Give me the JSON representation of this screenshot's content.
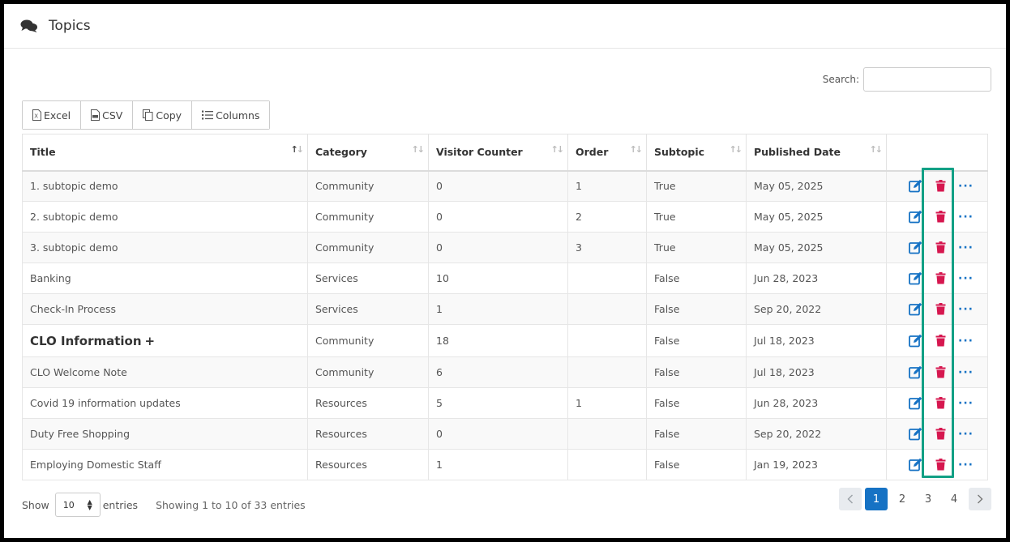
{
  "header": {
    "title": "Topics",
    "icon": "comments-icon"
  },
  "search": {
    "label": "Search:",
    "value": "",
    "placeholder": ""
  },
  "toolbar": {
    "excel": "Excel",
    "csv": "CSV",
    "copy": "Copy",
    "columns": "Columns"
  },
  "table": {
    "columns": [
      "Title",
      "Category",
      "Visitor Counter",
      "Order",
      "Subtopic",
      "Published Date"
    ],
    "rows": [
      {
        "title": "1. subtopic demo",
        "category": "Community",
        "visitors": "0",
        "order": "1",
        "subtopic": "True",
        "date": "May 05, 2025"
      },
      {
        "title": "2. subtopic demo",
        "category": "Community",
        "visitors": "0",
        "order": "2",
        "subtopic": "True",
        "date": "May 05, 2025"
      },
      {
        "title": "3. subtopic demo",
        "category": "Community",
        "visitors": "0",
        "order": "3",
        "subtopic": "True",
        "date": "May 05, 2025"
      },
      {
        "title": "Banking",
        "category": "Services",
        "visitors": "10",
        "order": "",
        "subtopic": "False",
        "date": "Jun 28, 2023"
      },
      {
        "title": "Check-In Process",
        "category": "Services",
        "visitors": "1",
        "order": "",
        "subtopic": "False",
        "date": "Sep 20, 2022"
      },
      {
        "title": "CLO Information",
        "category": "Community",
        "visitors": "18",
        "order": "",
        "subtopic": "False",
        "date": "Jul 18, 2023",
        "expand": "+"
      },
      {
        "title": "CLO Welcome Note",
        "category": "Community",
        "visitors": "6",
        "order": "",
        "subtopic": "False",
        "date": "Jul 18, 2023"
      },
      {
        "title": "Covid 19 information updates",
        "category": "Resources",
        "visitors": "5",
        "order": "1",
        "subtopic": "False",
        "date": "Jun 28, 2023"
      },
      {
        "title": "Duty Free Shopping",
        "category": "Resources",
        "visitors": "0",
        "order": "",
        "subtopic": "False",
        "date": "Sep 20, 2022"
      },
      {
        "title": "Employing Domestic Staff",
        "category": "Resources",
        "visitors": "1",
        "order": "",
        "subtopic": "False",
        "date": "Jan 19, 2023"
      }
    ]
  },
  "footer": {
    "show_label": "Show",
    "page_length": "10",
    "entries_label": "entries",
    "info": "Showing 1 to 10 of 33 entries"
  },
  "pagination": {
    "pages": [
      "1",
      "2",
      "3",
      "4"
    ],
    "current": "1"
  },
  "colors": {
    "edit": "#1672c4",
    "delete": "#d6174f",
    "highlight": "#12a085",
    "active_page": "#1672c4"
  }
}
